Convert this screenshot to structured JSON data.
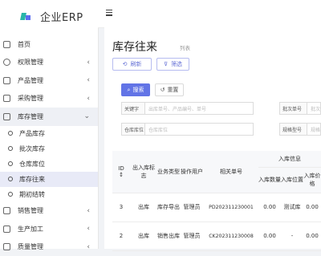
{
  "app": {
    "name": "企业ERP"
  },
  "sidebar": {
    "items": [
      {
        "label": "首页",
        "icon": "home-icon",
        "chevron": ""
      },
      {
        "label": "权限管理",
        "icon": "gear-icon",
        "chevron": "‹"
      },
      {
        "label": "产品管理",
        "icon": "box-icon",
        "chevron": "‹"
      },
      {
        "label": "采购管理",
        "icon": "cart-icon",
        "chevron": "‹"
      },
      {
        "label": "库存管理",
        "icon": "warehouse-icon",
        "chevron": "⌄"
      }
    ],
    "subitems": [
      {
        "label": "产品库存"
      },
      {
        "label": "批次库存"
      },
      {
        "label": "仓库库位"
      },
      {
        "label": "库存往来"
      },
      {
        "label": "期初结转"
      }
    ],
    "bottom_items": [
      {
        "label": "销售管理",
        "icon": "sales-icon",
        "chevron": "‹"
      },
      {
        "label": "生产加工",
        "icon": "factory-icon",
        "chevron": "‹"
      },
      {
        "label": "质量管理",
        "icon": "quality-icon",
        "chevron": "‹"
      }
    ]
  },
  "header": {
    "menu_icon": "hamburger-icon"
  },
  "page": {
    "title": "库存往来",
    "subtitle": "列表",
    "refresh_label": "刷新",
    "filter_label": "筛选",
    "search_label": "搜索",
    "reset_label": "重置"
  },
  "filters": [
    {
      "label": "关键字",
      "placeholder": "出库单号、产品编号、单号"
    },
    {
      "label": "批次单号",
      "placeholder": "批次"
    },
    {
      "label": "仓库库位",
      "placeholder": "仓库库位"
    },
    {
      "label": "规格型号",
      "placeholder": "规格"
    }
  ],
  "table": {
    "group_header": "入库信息",
    "columns": [
      "ID",
      "出入库标志",
      "业务类型",
      "操作用户",
      "相关单号",
      "入库数量",
      "入库位置",
      "入库价格"
    ],
    "rows": [
      [
        "3",
        "出库",
        "库存导出",
        "管理员",
        "PD202311230001",
        "0.00",
        "测试库",
        "0.00"
      ],
      [
        "2",
        "出库",
        "销售出库",
        "管理员",
        "CK202311230008",
        "0.00",
        "-",
        "0.00"
      ]
    ]
  }
}
